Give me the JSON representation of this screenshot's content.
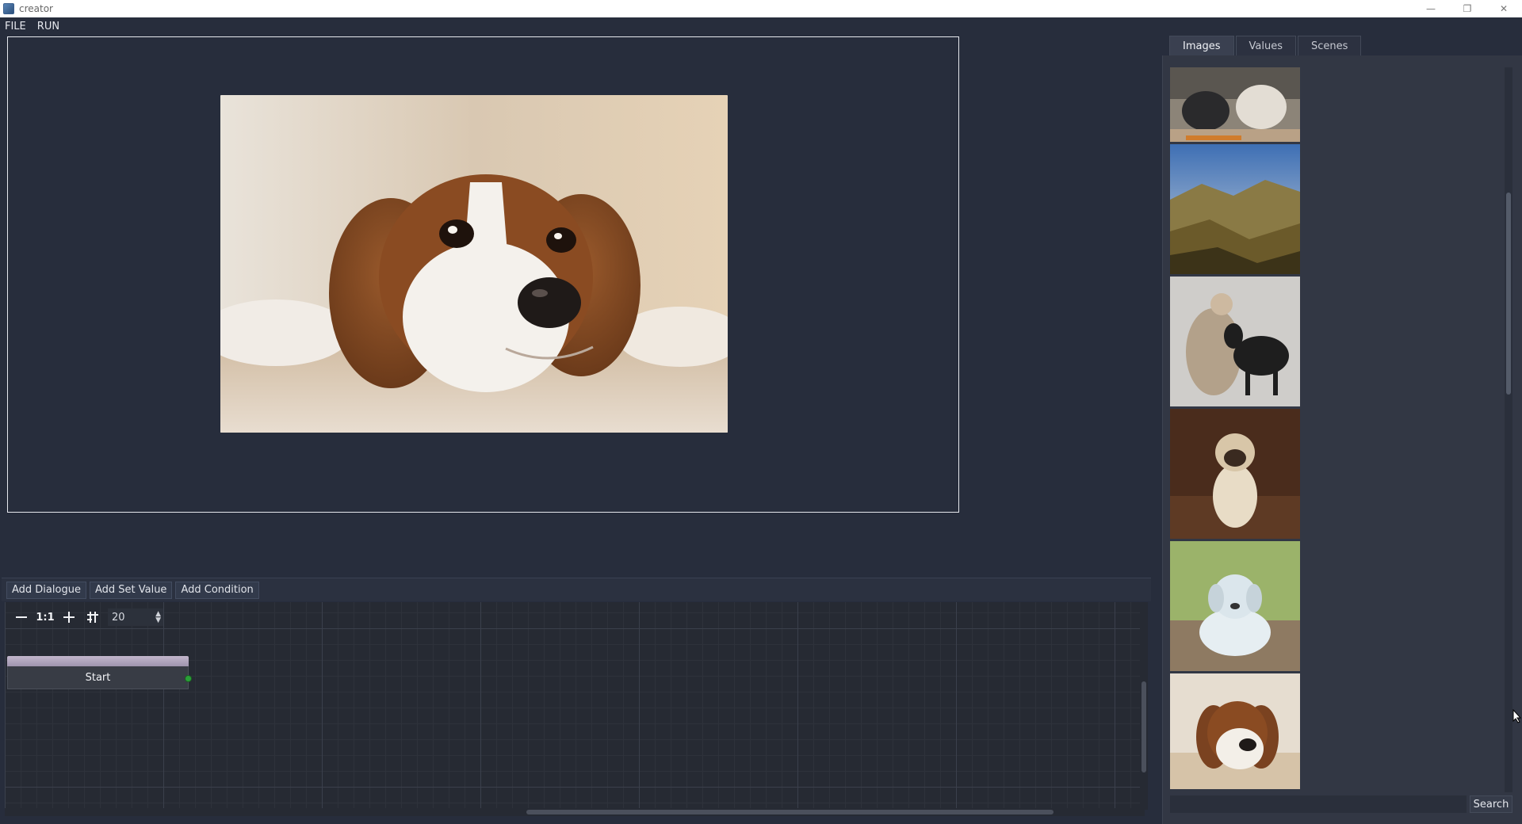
{
  "window": {
    "title": "creator",
    "controls": {
      "minimize": "—",
      "restore": "❐",
      "close": "✕"
    }
  },
  "menu": {
    "items": [
      "FILE",
      "RUN"
    ]
  },
  "scene": {
    "preview_image": "dog-lying-on-carpet"
  },
  "node_editor": {
    "toolbar": {
      "add_dialogue": "Add Dialogue",
      "add_set_value": "Add Set Value",
      "add_condition": "Add Condition"
    },
    "tools": {
      "zoom_out_icon": "minus-icon",
      "reset_zoom_label": "1:1",
      "zoom_in_icon": "plus-icon",
      "grid_icon": "grid-snap-icon",
      "grid_size": "20"
    },
    "start_node": {
      "label": "Start",
      "port_color": "#2aa038"
    }
  },
  "right_panel": {
    "tabs": [
      "Images",
      "Values",
      "Scenes"
    ],
    "active_tab": "Images",
    "thumbnails": [
      "people-sitting",
      "mountain-landscape",
      "soldier-with-black-dog",
      "pug-standing",
      "white-puppy-lying",
      "spaniel-lying"
    ],
    "search": {
      "value": "",
      "button_label": "Search"
    }
  }
}
